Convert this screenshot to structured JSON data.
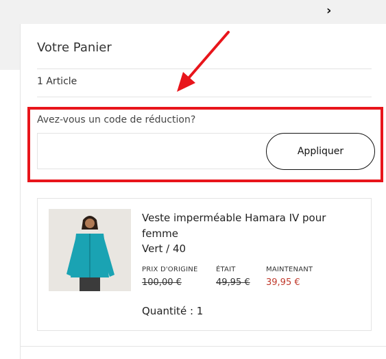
{
  "header": {
    "chevron_icon": "chevron-right-icon"
  },
  "cart": {
    "title": "Votre Panier",
    "item_count": "1 Article",
    "promo": {
      "label": "Avez-vous un code de réduction?",
      "input_value": "",
      "apply_label": "Appliquer"
    },
    "items": [
      {
        "name": "Veste imperméable Hamara IV pour femme",
        "variant": "Vert / 40",
        "prices": {
          "original_label": "PRIX D'ORIGINE",
          "original_value": "100,00 €",
          "was_label": "ÉTAIT",
          "was_value": "49,95 €",
          "now_label": "MAINTENANT",
          "now_value": "39,95 €"
        },
        "quantity": "Quantité : 1"
      }
    ]
  },
  "colors": {
    "highlight": "#e8151b",
    "sale_price": "#c0392b",
    "jacket": "#1aa3b3"
  }
}
